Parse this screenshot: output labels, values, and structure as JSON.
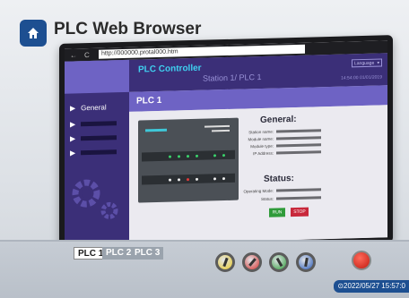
{
  "app": {
    "title": "PLC Web Browser"
  },
  "browser": {
    "url": "http://000000.protal000.htm",
    "back": "←",
    "reload": "C"
  },
  "header": {
    "title": "PLC Controller",
    "subtitle": "Station 1/ PLC 1",
    "language": "Language",
    "timestamp": "14:54:00 01/01/2019"
  },
  "sidebar": {
    "items": [
      {
        "label": "General"
      }
    ]
  },
  "page": {
    "title": "PLC 1"
  },
  "general": {
    "title": "General:",
    "fields": [
      {
        "label": "Station name:"
      },
      {
        "label": "Module name:"
      },
      {
        "label": "Module type:"
      },
      {
        "label": "IP Address:"
      }
    ]
  },
  "status": {
    "title": "Status:",
    "fields": [
      {
        "label": "Operating Mode:"
      },
      {
        "label": "Status:"
      }
    ],
    "run_label": "RUN",
    "stop_label": "STOP"
  },
  "tabs": [
    {
      "label": "PLC 1"
    },
    {
      "label": "PLC 2"
    },
    {
      "label": "PLC 3"
    }
  ],
  "knobs": [
    {
      "color": "#e8c92a"
    },
    {
      "color": "#d6322e"
    },
    {
      "color": "#2f9b3a"
    },
    {
      "color": "#2b5bb8"
    }
  ],
  "footer": {
    "datetime": "2022/05/27 15:57:0"
  },
  "colors": {
    "accent": "#1d4f91",
    "sidebar": "#3b2f78",
    "header_accent": "#3fd0f0"
  }
}
